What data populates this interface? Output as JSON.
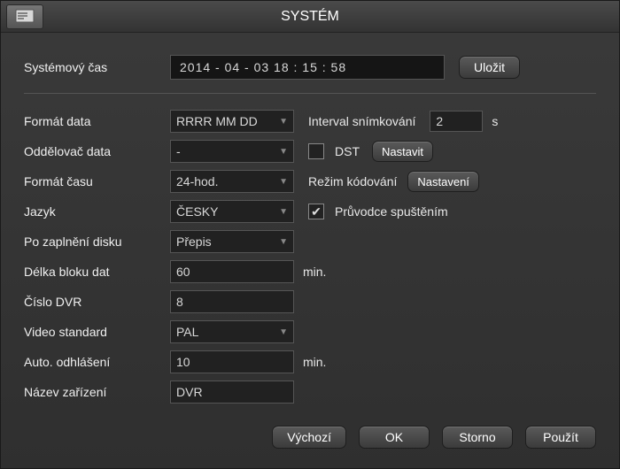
{
  "title": "SYSTÉM",
  "labels": {
    "systemTime": "Systémový čas",
    "dateFormat": "Formát data",
    "dateSeparator": "Oddělovač data",
    "timeFormat": "Formát času",
    "language": "Jazyk",
    "diskFull": "Po zaplnění disku",
    "blockLength": "Délka bloku dat",
    "dvrNumber": "Číslo DVR",
    "videoStandard": "Video standard",
    "autoLogout": "Auto. odhlášení",
    "deviceName": "Název zařízení",
    "snapshotInterval": "Interval snímkování",
    "dst": "DST",
    "encodeMode": "Režim kódování",
    "startupWizard": "Průvodce spuštěním",
    "minSuffix": "min.",
    "secSuffix": "s"
  },
  "values": {
    "systemTime": "2014  - 04  - 03    18 : 15 :  58",
    "dateFormat": "RRRR MM DD",
    "dateSeparator": "-",
    "timeFormat": "24-hod.",
    "language": "ČESKY",
    "diskFull": "Přepis",
    "blockLength": "60",
    "dvrNumber": "8",
    "videoStandard": "PAL",
    "autoLogout": "10",
    "deviceName": "DVR",
    "snapshotInterval": "2",
    "dstChecked": false,
    "wizardChecked": true
  },
  "buttons": {
    "save": "Uložit",
    "set": "Nastavit",
    "settings": "Nastavení",
    "default": "Výchozí",
    "ok": "OK",
    "cancel": "Storno",
    "apply": "Použít"
  }
}
